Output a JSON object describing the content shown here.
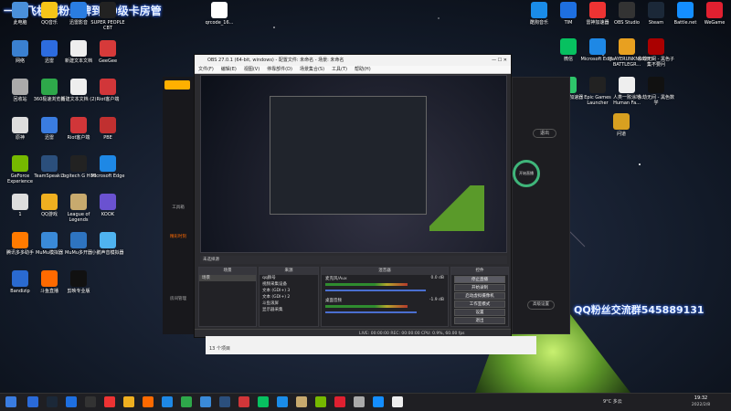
{
  "overlay": {
    "stream_title": "一哈飞机或粉丝牌到10级卡房管",
    "fan_group": "QQ粉丝交流群545889131"
  },
  "desktop": {
    "left_icons": [
      {
        "label": "此电脑",
        "color": "#4a90d9"
      },
      {
        "label": "QQ音乐",
        "color": "#f5c518"
      },
      {
        "label": "迅雷影音",
        "color": "#2a7de1"
      },
      {
        "label": "SUPER PEOPLE CBT",
        "color": "#222"
      },
      {
        "label": "网络",
        "color": "#3a80d0"
      },
      {
        "label": "迅雷",
        "color": "#2d6cdf"
      },
      {
        "label": "新建文本文档",
        "color": "#eee"
      },
      {
        "label": "GeeGee",
        "color": "#d63a3a"
      },
      {
        "label": "回收站",
        "color": "#aaa"
      },
      {
        "label": "360极速浏览器",
        "color": "#2ea84a"
      },
      {
        "label": "新建文本文档 (2)",
        "color": "#eee"
      },
      {
        "label": "Riot客户端",
        "color": "#d13639"
      },
      {
        "label": "原神",
        "color": "#ddd"
      },
      {
        "label": "迅雷",
        "color": "#3a7ce0"
      },
      {
        "label": "Riot客户端",
        "color": "#d13639"
      },
      {
        "label": "PBE",
        "color": "#c03030"
      },
      {
        "label": "GeForce Experience",
        "color": "#76b900"
      },
      {
        "label": "TeamSpeak 3",
        "color": "#2b4f7c"
      },
      {
        "label": "Logitech G HUB",
        "color": "#222"
      },
      {
        "label": "Microsoft Edge",
        "color": "#1e88e5"
      },
      {
        "label": "1",
        "color": "#ddd"
      },
      {
        "label": "QQ游戏",
        "color": "#f0b020"
      },
      {
        "label": "League of Legends",
        "color": "#c8aa6e"
      },
      {
        "label": "KOOK",
        "color": "#6a52d0"
      },
      {
        "label": "腾讯多多助手",
        "color": "#ff7a00"
      },
      {
        "label": "MuMu模拟器",
        "color": "#3a8ad8"
      },
      {
        "label": "MuMu多开器",
        "color": "#2e74c0"
      },
      {
        "label": "小鹅声音模拟器",
        "color": "#4fb3f0"
      },
      {
        "label": "Bandizip",
        "color": "#2a6ad0"
      },
      {
        "label": "斗鱼直播",
        "color": "#ff6a00"
      },
      {
        "label": "剪映专业版",
        "color": "#111"
      }
    ],
    "right_icons": [
      {
        "label": "酷狗音乐",
        "color": "#1a8ce8"
      },
      {
        "label": "TIM",
        "color": "#1e6fe0"
      },
      {
        "label": "雷神加速器",
        "color": "#e33"
      },
      {
        "label": "OBS Studio",
        "color": "#333"
      },
      {
        "label": "Steam",
        "color": "#1b2838"
      },
      {
        "label": "Battle.net",
        "color": "#148eff"
      },
      {
        "label": "WeGame",
        "color": "#e02030"
      },
      {
        "label": "微信",
        "color": "#07c160"
      },
      {
        "label": "Microsoft Edge",
        "color": "#1e88e5"
      },
      {
        "label": "PLAYERUNKNOWN'S BATTLEGR...",
        "color": "#e8a020"
      },
      {
        "label": "永劫无间 - 黑色子集不要问",
        "color": "#a00"
      },
      {
        "label": "网易UU加速器",
        "color": "#2ec66b"
      },
      {
        "label": "Epic Games Launcher",
        "color": "#222"
      },
      {
        "label": "人类一败涂地 Human Fa...",
        "color": "#eee"
      },
      {
        "label": "永劫无间 - 黑色数学",
        "color": "#111"
      },
      {
        "label": "问道",
        "color": "#d8a020"
      }
    ]
  },
  "obs": {
    "title": "OBS 27.0.1 (64-bit, windows) - 配置文件: 未命名 - 场景: 未命名",
    "menu": [
      "文件(F)",
      "编辑(E)",
      "视图(V)",
      "停靠部件(D)",
      "场景集合(S)",
      "工具(T)",
      "帮助(H)"
    ],
    "scenes_header": "场景",
    "sources_header": "来源",
    "mixer_header": "混音器",
    "controls_header": "控件",
    "scene_items": [
      "场景"
    ],
    "source_items": [
      "qq群号",
      "视频采集设备",
      "文本 (GDI+) 3",
      "文本 (GDI+) 2",
      "斗鱼滚屏",
      "显示器采集"
    ],
    "mixer_items": [
      {
        "name": "麦克风/Aux",
        "db": "0.0 dB"
      },
      {
        "name": "桌面音频",
        "db": "-1.9 dB"
      }
    ],
    "controls": [
      "停止直播",
      "开始录制",
      "启动虚拟摄像机",
      "工作室模式",
      "设置",
      "退出"
    ],
    "status": "LIVE: 00:00:00   REC: 00:00:00   CPU: 0.9%, 60.00 fps",
    "preview_tag": "未选择源"
  },
  "right_panel": {
    "exit_label": "退出",
    "advanced_label": "高级设置",
    "start_label": "开始直播"
  },
  "left_sidebar": {
    "items": [
      "工具箱",
      "精彩时刻",
      "房间管理"
    ]
  },
  "small_window": {
    "text": "13 个项目"
  },
  "taskbar": {
    "weather": "9°C 多云",
    "time": "19:32",
    "date": "2022/2/8",
    "icons": [
      "#2a6ad8",
      "#1b2838",
      "#1e6fe0",
      "#333",
      "#e33",
      "#f0b020",
      "#ff6a00",
      "#1e88e5",
      "#2ea84a",
      "#3a8ad8",
      "#2b4f7c",
      "#d13639",
      "#07c160",
      "#1a8ce8",
      "#c8aa6e",
      "#76b900",
      "#e02030",
      "#aaa",
      "#148eff",
      "#eee"
    ]
  }
}
